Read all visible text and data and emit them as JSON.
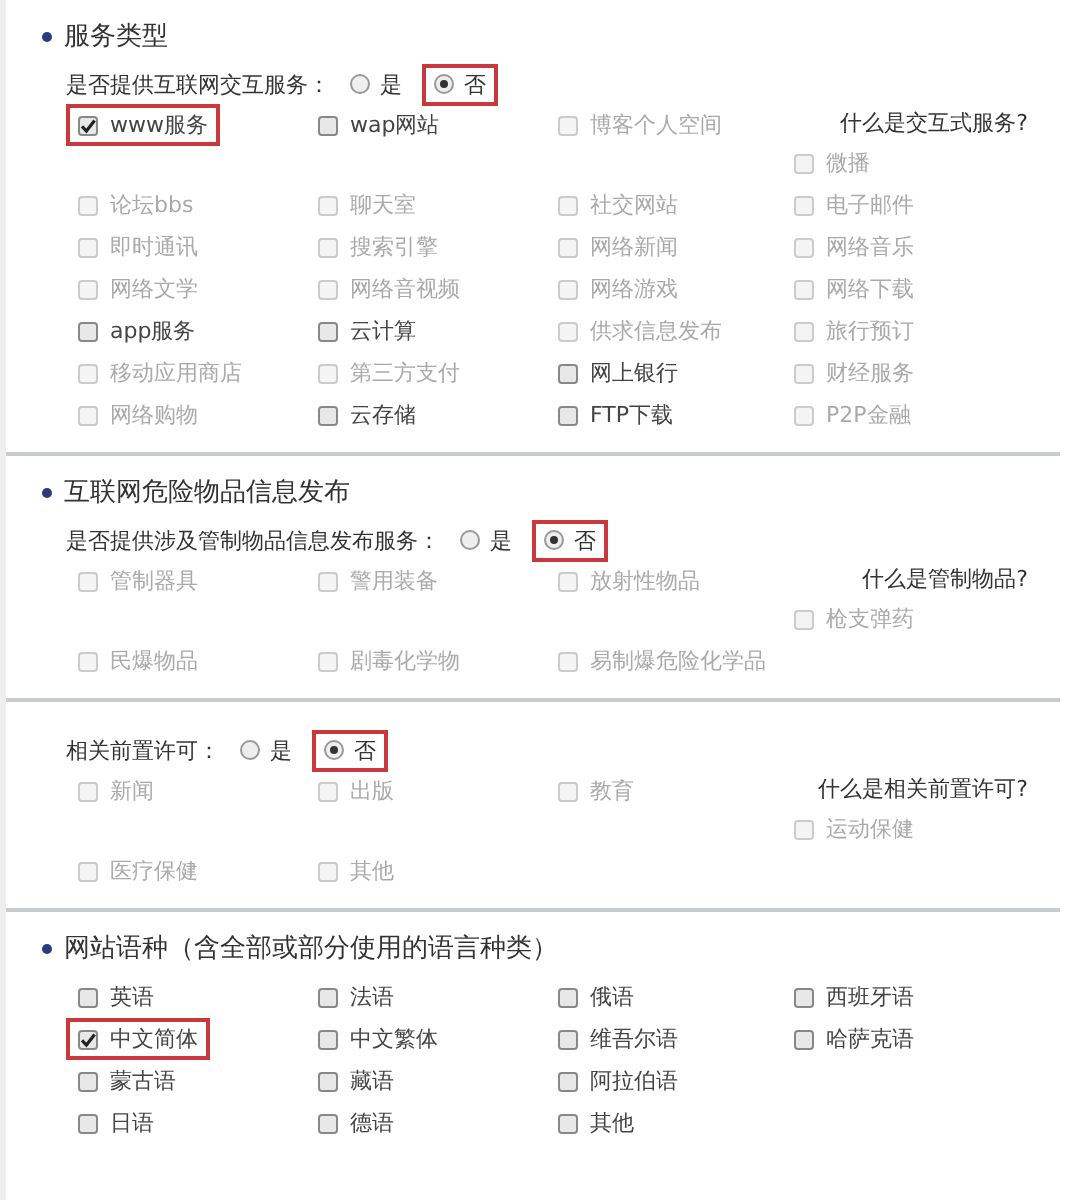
{
  "sections": [
    {
      "title": "服务类型",
      "question": {
        "label": "是否提供互联网交互服务：",
        "options": [
          {
            "label": "是",
            "selected": false,
            "highlighted": false
          },
          {
            "label": "否",
            "selected": true,
            "highlighted": true
          }
        ]
      },
      "help_link": "什么是交互式服务?",
      "rows": [
        [
          {
            "label": "www服务",
            "checked": true,
            "disabled": false,
            "highlighted": true
          },
          {
            "label": "wap网站",
            "checked": false,
            "disabled": false,
            "highlighted": false
          },
          {
            "label": "博客个人空间",
            "checked": false,
            "disabled": true,
            "highlighted": false
          },
          {
            "label": "微播",
            "checked": false,
            "disabled": true,
            "highlighted": false
          }
        ],
        [
          {
            "label": "论坛bbs",
            "checked": false,
            "disabled": true,
            "highlighted": false
          },
          {
            "label": "聊天室",
            "checked": false,
            "disabled": true,
            "highlighted": false
          },
          {
            "label": "社交网站",
            "checked": false,
            "disabled": true,
            "highlighted": false
          },
          {
            "label": "电子邮件",
            "checked": false,
            "disabled": true,
            "highlighted": false
          }
        ],
        [
          {
            "label": "即时通讯",
            "checked": false,
            "disabled": true,
            "highlighted": false
          },
          {
            "label": "搜索引擎",
            "checked": false,
            "disabled": true,
            "highlighted": false
          },
          {
            "label": "网络新闻",
            "checked": false,
            "disabled": true,
            "highlighted": false
          },
          {
            "label": "网络音乐",
            "checked": false,
            "disabled": true,
            "highlighted": false
          }
        ],
        [
          {
            "label": "网络文学",
            "checked": false,
            "disabled": true,
            "highlighted": false
          },
          {
            "label": "网络音视频",
            "checked": false,
            "disabled": true,
            "highlighted": false
          },
          {
            "label": "网络游戏",
            "checked": false,
            "disabled": true,
            "highlighted": false
          },
          {
            "label": "网络下载",
            "checked": false,
            "disabled": true,
            "highlighted": false
          }
        ],
        [
          {
            "label": "app服务",
            "checked": false,
            "disabled": false,
            "highlighted": false
          },
          {
            "label": "云计算",
            "checked": false,
            "disabled": false,
            "highlighted": false
          },
          {
            "label": "供求信息发布",
            "checked": false,
            "disabled": true,
            "highlighted": false
          },
          {
            "label": "旅行预订",
            "checked": false,
            "disabled": true,
            "highlighted": false
          }
        ],
        [
          {
            "label": "移动应用商店",
            "checked": false,
            "disabled": true,
            "highlighted": false
          },
          {
            "label": "第三方支付",
            "checked": false,
            "disabled": true,
            "highlighted": false
          },
          {
            "label": "网上银行",
            "checked": false,
            "disabled": false,
            "highlighted": false
          },
          {
            "label": "财经服务",
            "checked": false,
            "disabled": true,
            "highlighted": false
          }
        ],
        [
          {
            "label": "网络购物",
            "checked": false,
            "disabled": true,
            "highlighted": false
          },
          {
            "label": "云存储",
            "checked": false,
            "disabled": false,
            "highlighted": false
          },
          {
            "label": "FTP下载",
            "checked": false,
            "disabled": false,
            "highlighted": false
          },
          {
            "label": "P2P金融",
            "checked": false,
            "disabled": true,
            "highlighted": false
          }
        ]
      ]
    },
    {
      "title": "互联网危险物品信息发布",
      "question": {
        "label": "是否提供涉及管制物品信息发布服务：",
        "options": [
          {
            "label": "是",
            "selected": false,
            "highlighted": false
          },
          {
            "label": "否",
            "selected": true,
            "highlighted": true
          }
        ]
      },
      "help_link": "什么是管制物品?",
      "rows": [
        [
          {
            "label": "管制器具",
            "checked": false,
            "disabled": true,
            "highlighted": false
          },
          {
            "label": "警用装备",
            "checked": false,
            "disabled": true,
            "highlighted": false
          },
          {
            "label": "放射性物品",
            "checked": false,
            "disabled": true,
            "highlighted": false
          },
          {
            "label": "枪支弹药",
            "checked": false,
            "disabled": true,
            "highlighted": false
          }
        ],
        [
          {
            "label": "民爆物品",
            "checked": false,
            "disabled": true,
            "highlighted": false
          },
          {
            "label": "剧毒化学物",
            "checked": false,
            "disabled": true,
            "highlighted": false
          },
          {
            "label": "易制爆危险化学品",
            "checked": false,
            "disabled": true,
            "highlighted": false
          }
        ]
      ]
    },
    {
      "question": {
        "label": "相关前置许可：",
        "options": [
          {
            "label": "是",
            "selected": false,
            "highlighted": false
          },
          {
            "label": "否",
            "selected": true,
            "highlighted": true
          }
        ]
      },
      "help_link": "什么是相关前置许可?",
      "rows": [
        [
          {
            "label": "新闻",
            "checked": false,
            "disabled": true,
            "highlighted": false
          },
          {
            "label": "出版",
            "checked": false,
            "disabled": true,
            "highlighted": false
          },
          {
            "label": "教育",
            "checked": false,
            "disabled": true,
            "highlighted": false
          },
          {
            "label": "运动保健",
            "checked": false,
            "disabled": true,
            "highlighted": false
          }
        ],
        [
          {
            "label": "医疗保健",
            "checked": false,
            "disabled": true,
            "highlighted": false
          },
          {
            "label": "其他",
            "checked": false,
            "disabled": true,
            "highlighted": false
          }
        ]
      ]
    },
    {
      "title": "网站语种（含全部或部分使用的语言种类）",
      "rows": [
        [
          {
            "label": "英语",
            "checked": false,
            "disabled": false,
            "highlighted": false
          },
          {
            "label": "法语",
            "checked": false,
            "disabled": false,
            "highlighted": false
          },
          {
            "label": "俄语",
            "checked": false,
            "disabled": false,
            "highlighted": false
          },
          {
            "label": "西班牙语",
            "checked": false,
            "disabled": false,
            "highlighted": false
          }
        ],
        [
          {
            "label": "中文简体",
            "checked": true,
            "disabled": false,
            "highlighted": true
          },
          {
            "label": "中文繁体",
            "checked": false,
            "disabled": false,
            "highlighted": false
          },
          {
            "label": "维吾尔语",
            "checked": false,
            "disabled": false,
            "highlighted": false
          },
          {
            "label": "哈萨克语",
            "checked": false,
            "disabled": false,
            "highlighted": false
          }
        ],
        [
          {
            "label": "蒙古语",
            "checked": false,
            "disabled": false,
            "highlighted": false
          },
          {
            "label": "藏语",
            "checked": false,
            "disabled": false,
            "highlighted": false
          },
          {
            "label": "阿拉伯语",
            "checked": false,
            "disabled": false,
            "highlighted": false
          }
        ],
        [
          {
            "label": "日语",
            "checked": false,
            "disabled": false,
            "highlighted": false
          },
          {
            "label": "德语",
            "checked": false,
            "disabled": false,
            "highlighted": false
          },
          {
            "label": "其他",
            "checked": false,
            "disabled": false,
            "highlighted": false
          }
        ]
      ]
    }
  ]
}
